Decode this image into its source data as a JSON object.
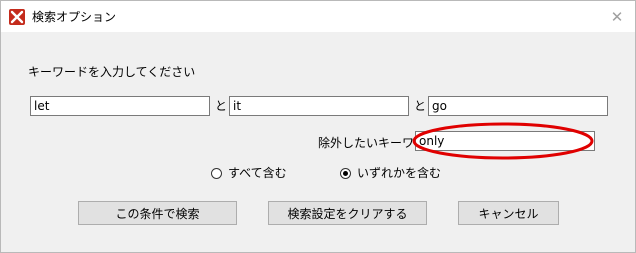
{
  "window": {
    "title": "検索オプション",
    "close_symbol": "✕",
    "accent_color": "#c42b1c"
  },
  "form": {
    "instruction": "キーワードを入力してください",
    "keyword1": "let",
    "keyword2": "it",
    "keyword3": "go",
    "connector1": "と",
    "connector2": "と",
    "exclude_label": "除外したいキーワード",
    "exclude_value": "only"
  },
  "options": {
    "all_label": "すべて含む",
    "any_label": "いずれかを含む",
    "selected": "any"
  },
  "buttons": {
    "search": "この条件で検索",
    "clear": "検索設定をクリアする",
    "cancel": "キャンセル"
  },
  "annotation": {
    "ellipse_color": "#e00000"
  }
}
